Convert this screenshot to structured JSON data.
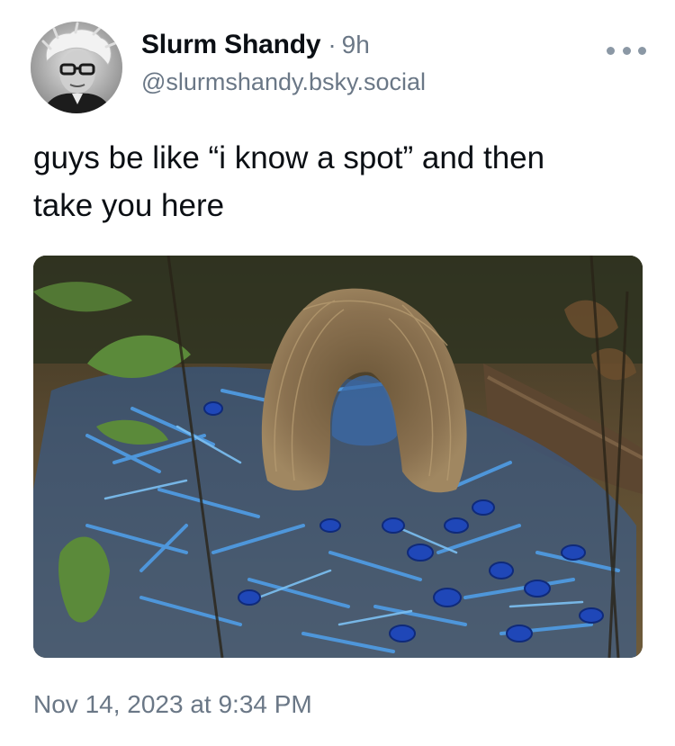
{
  "post": {
    "author": {
      "display_name": "Slurm Shandy",
      "separator": "·",
      "time_ago": "9h",
      "handle": "@slurmshandy.bsky.social",
      "avatar_icon": "avatar-photo"
    },
    "more_icon": "more-horizontal-icon",
    "text_line_1": "guys be like “i know a spot” and then",
    "text_line_2": "take you here",
    "media": {
      "kind": "photo",
      "dominant_colors": [
        "#3a6fb0",
        "#6b5a3e",
        "#4a6b2e"
      ]
    },
    "timestamp": "Nov 14, 2023 at 9:34 PM"
  },
  "colors": {
    "text": "#0b0f14",
    "secondary_text": "#6a7786",
    "icon_gray": "#8b98a5",
    "background": "#ffffff"
  }
}
